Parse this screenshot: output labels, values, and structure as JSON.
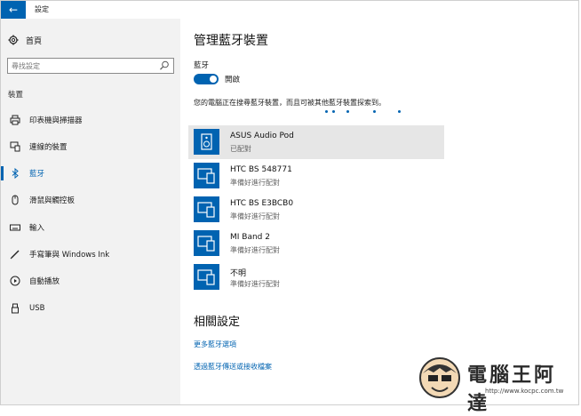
{
  "window": {
    "title": "設定",
    "back_glyph": "←"
  },
  "sidebar": {
    "home_label": "首頁",
    "search_placeholder": "尋找設定",
    "section": "裝置",
    "items": [
      {
        "label": "印表機與掃描器",
        "icon": "printer-icon",
        "active": false
      },
      {
        "label": "連線的裝置",
        "icon": "devices-icon",
        "active": false
      },
      {
        "label": "藍牙",
        "icon": "bluetooth-icon",
        "active": true
      },
      {
        "label": "滑鼠與觸控板",
        "icon": "mouse-icon",
        "active": false
      },
      {
        "label": "輸入",
        "icon": "keyboard-icon",
        "active": false
      },
      {
        "label": "手寫筆與 Windows Ink",
        "icon": "pen-icon",
        "active": false
      },
      {
        "label": "自動播放",
        "icon": "autoplay-icon",
        "active": false
      },
      {
        "label": "USB",
        "icon": "usb-icon",
        "active": false
      }
    ]
  },
  "main": {
    "title": "管理藍牙裝置",
    "bluetooth_label": "藍牙",
    "toggle_state": "開啟",
    "status": "您的電腦正在搜尋藍牙裝置，而且可被其他藍牙裝置探索到。",
    "devices": [
      {
        "name": "ASUS Audio Pod",
        "status": "已配對",
        "icon": "speaker-icon",
        "selected": true
      },
      {
        "name": "HTC BS 548771",
        "status": "準備好進行配對",
        "icon": "device-icon",
        "selected": false
      },
      {
        "name": "HTC BS E3BCB0",
        "status": "準備好進行配對",
        "icon": "device-icon",
        "selected": false
      },
      {
        "name": "MI Band 2",
        "status": "準備好進行配對",
        "icon": "device-icon",
        "selected": false
      },
      {
        "name": "不明",
        "status": "準備好進行配對",
        "icon": "device-icon",
        "selected": false
      }
    ],
    "related_title": "相關設定",
    "links": [
      "更多藍牙選項",
      "透過藍牙傳送或接收檔案"
    ]
  },
  "watermark": {
    "title": "電腦王阿達",
    "url": "http://www.kocpc.com.tw"
  },
  "colors": {
    "accent": "#0063b1",
    "sidebar_bg": "#f2f2f2",
    "selected_bg": "#e6e6e6"
  }
}
